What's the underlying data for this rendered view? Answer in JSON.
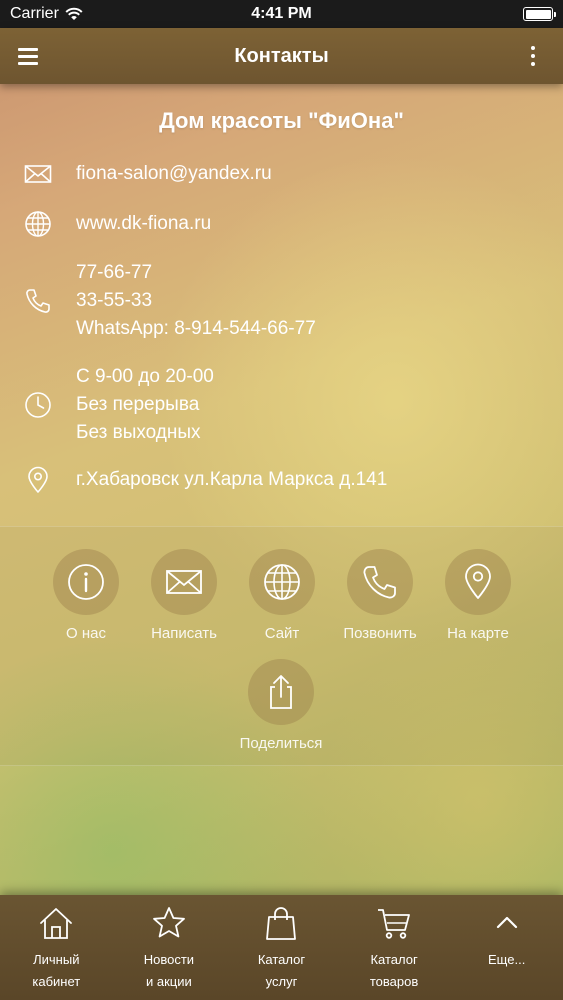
{
  "status_bar": {
    "carrier": "Carrier",
    "time": "4:41 PM"
  },
  "nav": {
    "title": "Контакты",
    "menu_icon": "hamburger-menu-icon",
    "more_icon": "more-vertical-icon"
  },
  "company": {
    "name": "Дом красоты \"ФиОна\""
  },
  "contacts": {
    "email": "fiona-salon@yandex.ru",
    "website": "www.dk-fiona.ru",
    "phones": [
      "77-66-77",
      "33-55-33",
      "WhatsApp: 8-914-544-66-77"
    ],
    "hours": [
      "С 9-00 до 20-00",
      "Без перерыва",
      "Без выходных"
    ],
    "address": "г.Хабаровск ул.Карла Маркса д.141"
  },
  "actions": [
    {
      "label": "О нас",
      "icon": "info-icon"
    },
    {
      "label": "Написать",
      "icon": "mail-icon"
    },
    {
      "label": "Сайт",
      "icon": "globe-icon"
    },
    {
      "label": "Позвонить",
      "icon": "phone-icon"
    },
    {
      "label": "На карте",
      "icon": "map-pin-icon"
    },
    {
      "label": "Поделиться",
      "icon": "share-icon"
    }
  ],
  "tabs": [
    {
      "line1": "Личный",
      "line2": "кабинет",
      "icon": "home-icon"
    },
    {
      "line1": "Новости",
      "line2": "и акции",
      "icon": "star-icon"
    },
    {
      "line1": "Каталог",
      "line2": "услуг",
      "icon": "shopping-bag-icon"
    },
    {
      "line1": "Каталог",
      "line2": "товаров",
      "icon": "cart-icon"
    },
    {
      "line1": "Еще...",
      "line2": "",
      "icon": "chevron-up-icon"
    }
  ]
}
